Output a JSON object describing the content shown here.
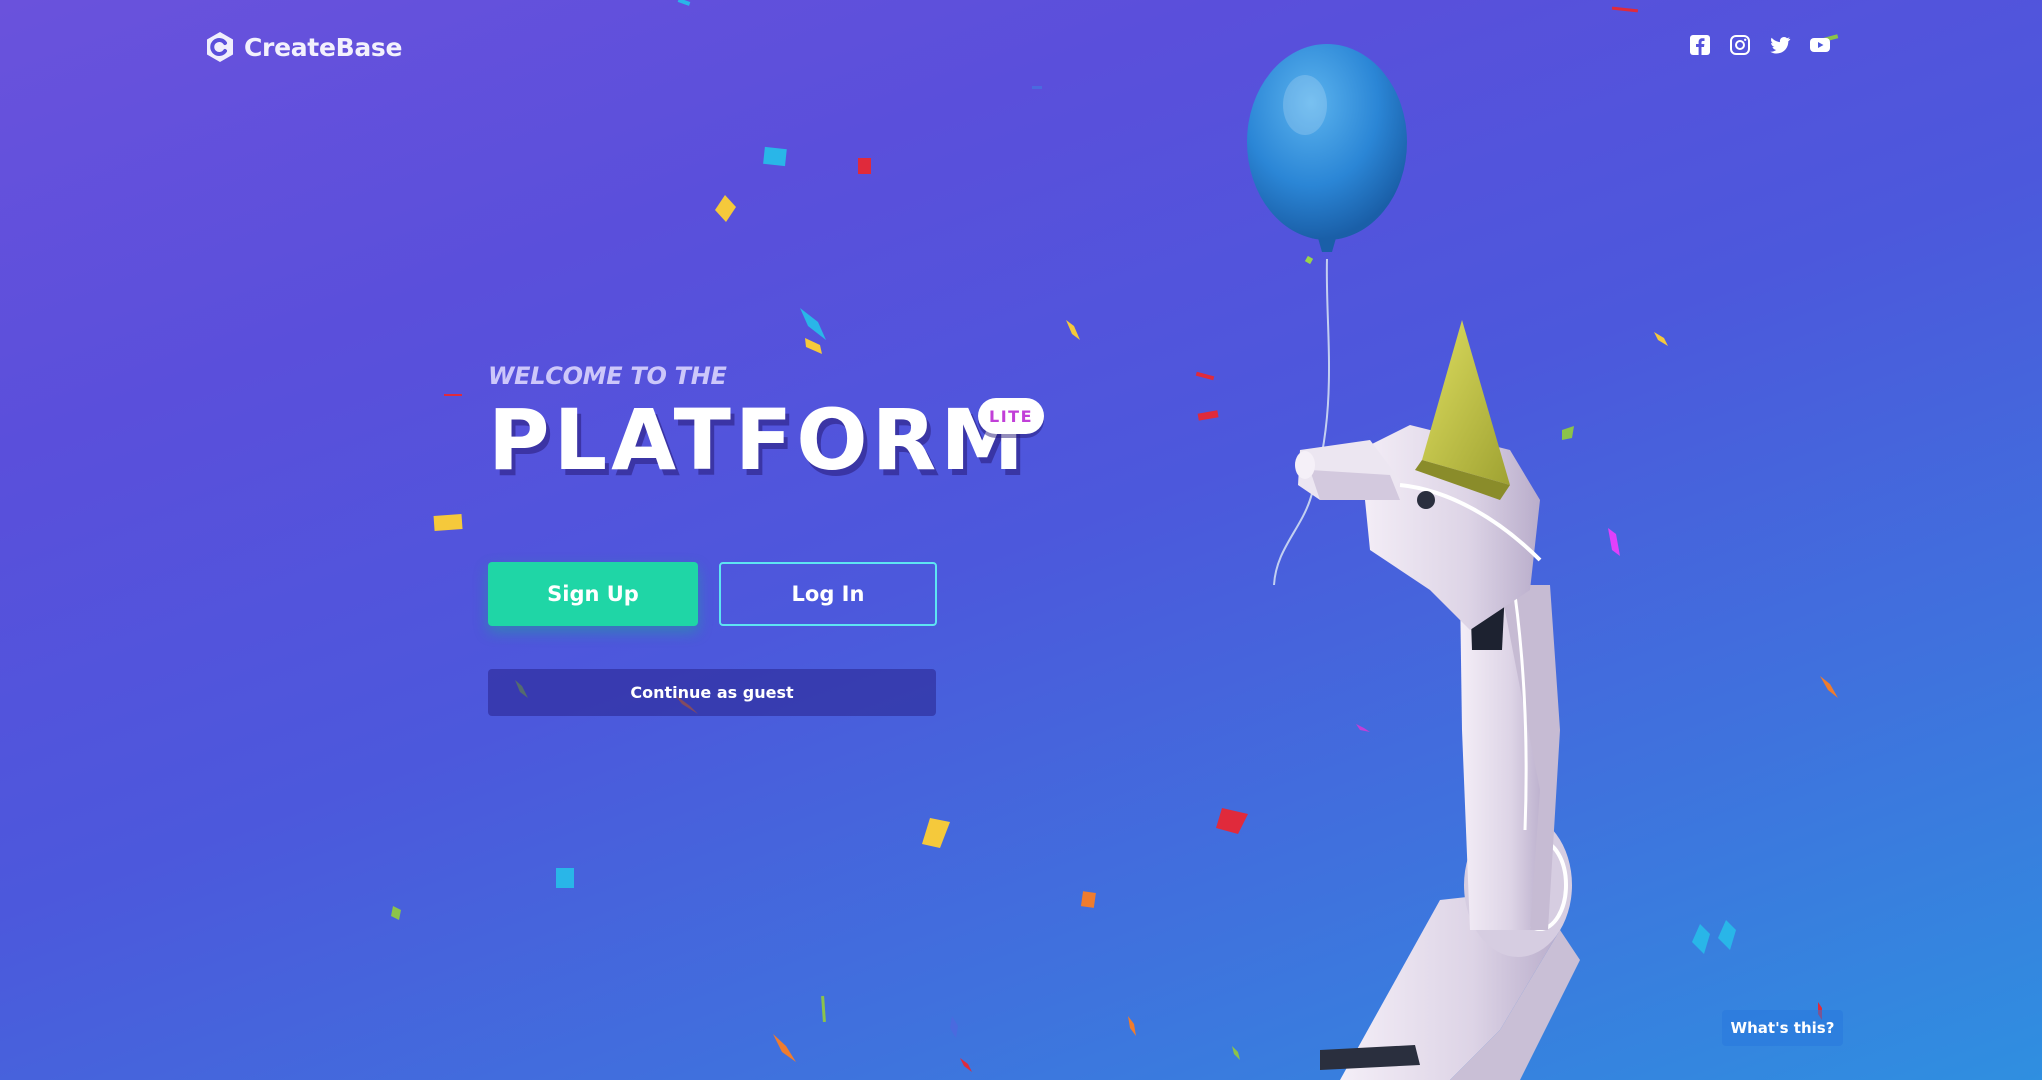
{
  "brand": {
    "name": "CreateBase",
    "logo_icon": "createbase-logo-icon"
  },
  "social": [
    {
      "name": "facebook",
      "icon": "facebook-icon"
    },
    {
      "name": "instagram",
      "icon": "instagram-icon"
    },
    {
      "name": "twitter",
      "icon": "twitter-icon"
    },
    {
      "name": "youtube",
      "icon": "youtube-icon"
    }
  ],
  "hero": {
    "welcome": "WELCOME TO THE",
    "title": "PLATFORM",
    "badge": "LITE"
  },
  "actions": {
    "signup": "Sign Up",
    "login": "Log In",
    "guest": "Continue as guest"
  },
  "help": {
    "whats_this": "What's this?"
  },
  "illustration": {
    "subject": "robot-arm-with-party-hat-and-balloon"
  },
  "colors": {
    "background_start": "#6a52dc",
    "background_end": "#2f8fe0",
    "signup_bg": "#1fd6a6",
    "login_border": "#5ee4f2",
    "badge_text": "#c13fd8",
    "balloon": "#2b86d6",
    "party_hat": "#c8c84a"
  }
}
